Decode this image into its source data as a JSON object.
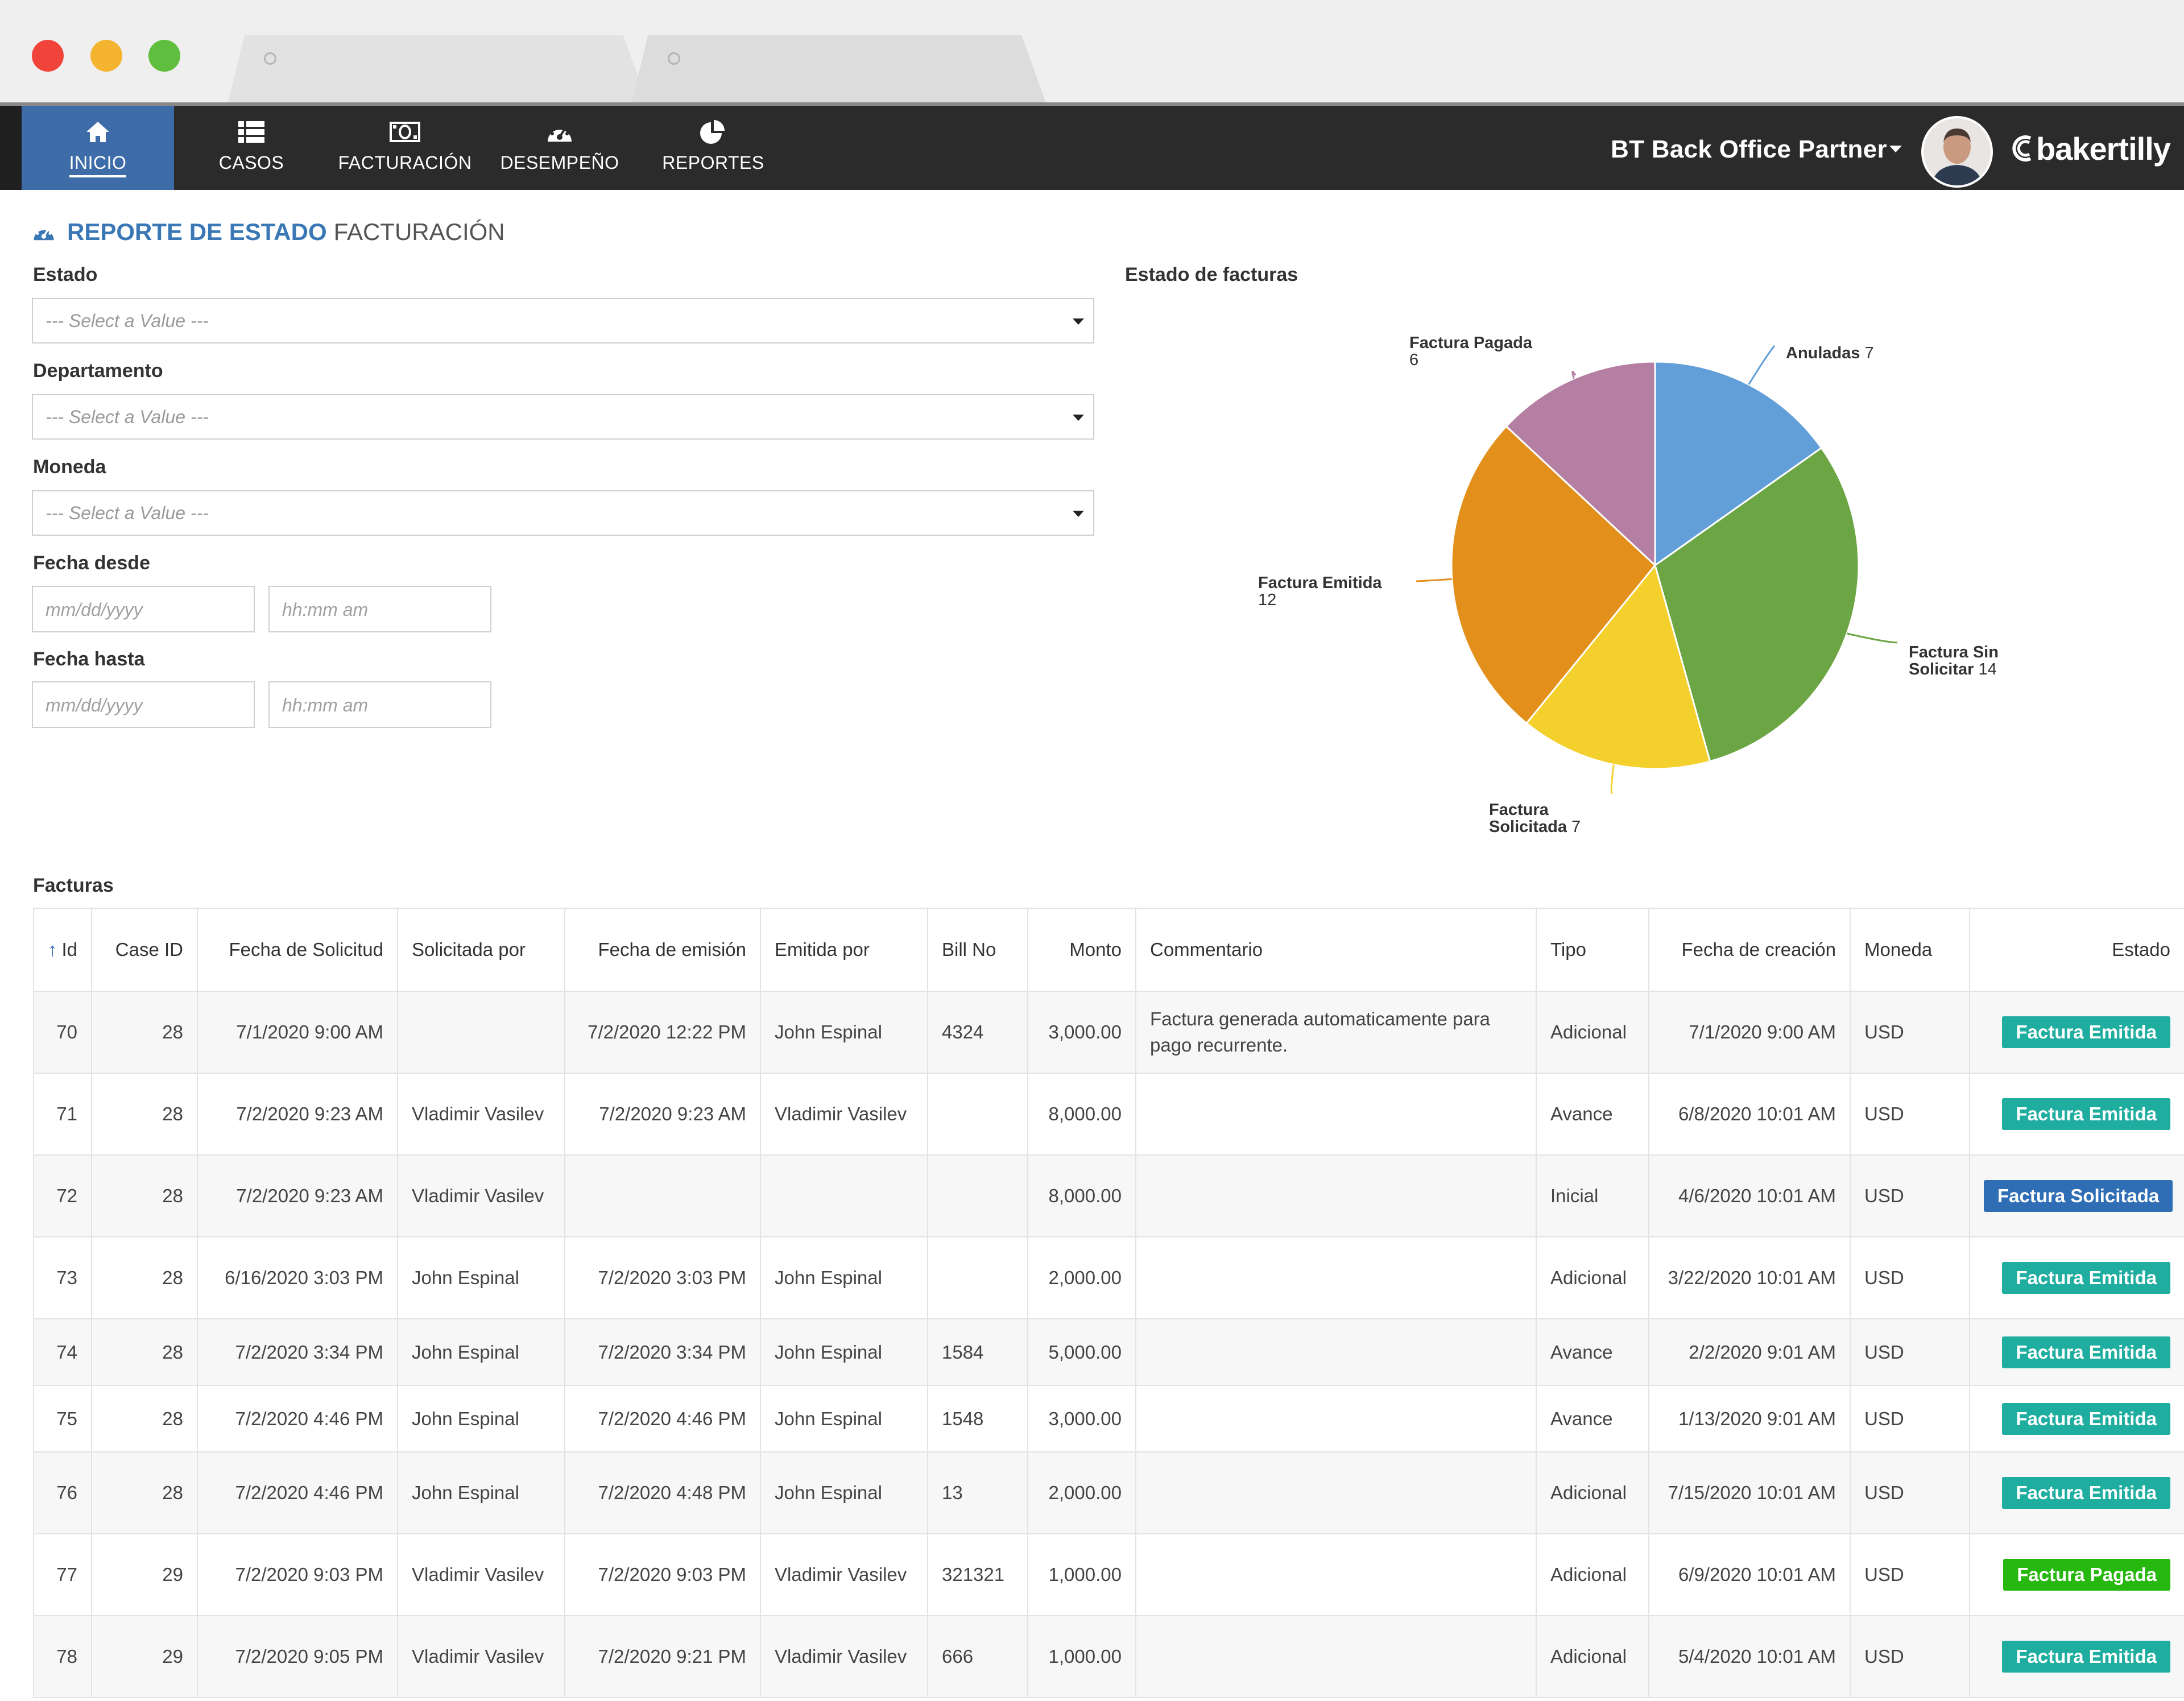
{
  "nav": {
    "items": [
      {
        "label": "INICIO",
        "icon": "home-icon",
        "active": true
      },
      {
        "label": "CASOS",
        "icon": "list-icon",
        "active": false
      },
      {
        "label": "FACTURACIÓN",
        "icon": "money-icon",
        "active": false
      },
      {
        "label": "DESEMPEÑO",
        "icon": "dashboard-icon",
        "active": false
      },
      {
        "label": "REPORTES",
        "icon": "pie-chart-icon",
        "active": false
      }
    ],
    "user_name": "BT Back Office Partner",
    "brand": "bakertilly"
  },
  "page": {
    "title_bold": "REPORTE DE ESTADO",
    "title_rest": "FACTURACIÓN"
  },
  "filters": {
    "estado": {
      "label": "Estado",
      "placeholder": "--- Select a Value ---"
    },
    "departamento": {
      "label": "Departamento",
      "placeholder": "--- Select a Value ---"
    },
    "moneda": {
      "label": "Moneda",
      "placeholder": "--- Select a Value ---"
    },
    "fecha_desde": {
      "label": "Fecha desde",
      "date_placeholder": "mm/dd/yyyy",
      "time_placeholder": "hh:mm am"
    },
    "fecha_hasta": {
      "label": "Fecha hasta",
      "date_placeholder": "mm/dd/yyyy",
      "time_placeholder": "hh:mm am"
    }
  },
  "chart_data": {
    "type": "pie",
    "title": "Estado de facturas",
    "slices": [
      {
        "label": "Anuladas",
        "value": 7,
        "color": "#629fd8"
      },
      {
        "label": "Factura Sin Solicitar",
        "value": 14,
        "color": "#6ba544"
      },
      {
        "label": "Factura Solicitada",
        "value": 7,
        "color": "#f4d02c"
      },
      {
        "label": "Factura Emitida",
        "value": 12,
        "color": "#e38f1b"
      },
      {
        "label": "Factura Pagada",
        "value": 6,
        "color": "#b47fa3"
      }
    ]
  },
  "table": {
    "title": "Facturas",
    "columns": [
      "Id",
      "Case ID",
      "Fecha de Solicitud",
      "Solicitada por",
      "Fecha de emisión",
      "Emitida por",
      "Bill No",
      "Monto",
      "Commentario",
      "Tipo",
      "Fecha de creación",
      "Moneda",
      "Estado"
    ],
    "rows": [
      {
        "id": "70",
        "case": "28",
        "fsol": "7/1/2020 9:00 AM",
        "solpor": "",
        "femi": "7/2/2020 12:22 PM",
        "emipor": "John Espinal",
        "bill": "4324",
        "monto": "3,000.00",
        "com": "Factura generada automaticamente para pago recurrente.",
        "tipo": "Adicional",
        "fcre": "7/1/2020 9:00 AM",
        "mon": "USD",
        "estado": "Factura Emitida",
        "ecolor": "#1fad9f"
      },
      {
        "id": "71",
        "case": "28",
        "fsol": "7/2/2020 9:23 AM",
        "solpor": "Vladimir Vasilev",
        "femi": "7/2/2020 9:23 AM",
        "emipor": "Vladimir Vasilev",
        "bill": "",
        "monto": "8,000.00",
        "com": "",
        "tipo": "Avance",
        "fcre": "6/8/2020 10:01 AM",
        "mon": "USD",
        "estado": "Factura Emitida",
        "ecolor": "#1fad9f"
      },
      {
        "id": "72",
        "case": "28",
        "fsol": "7/2/2020 9:23 AM",
        "solpor": "Vladimir Vasilev",
        "femi": "",
        "emipor": "",
        "bill": "",
        "monto": "8,000.00",
        "com": "",
        "tipo": "Inicial",
        "fcre": "4/6/2020 10:01 AM",
        "mon": "USD",
        "estado": "Factura Solicitada",
        "ecolor": "#2f6eb5"
      },
      {
        "id": "73",
        "case": "28",
        "fsol": "6/16/2020 3:03 PM",
        "solpor": "John Espinal",
        "femi": "7/2/2020 3:03 PM",
        "emipor": "John Espinal",
        "bill": "",
        "monto": "2,000.00",
        "com": "",
        "tipo": "Adicional",
        "fcre": "3/22/2020 10:01 AM",
        "mon": "USD",
        "estado": "Factura Emitida",
        "ecolor": "#1fad9f"
      },
      {
        "id": "74",
        "case": "28",
        "fsol": "7/2/2020 3:34 PM",
        "solpor": "John Espinal",
        "femi": "7/2/2020 3:34 PM",
        "emipor": "John Espinal",
        "bill": "1584",
        "monto": "5,000.00",
        "com": "",
        "tipo": "Avance",
        "fcre": "2/2/2020 9:01 AM",
        "mon": "USD",
        "estado": "Factura Emitida",
        "ecolor": "#1fad9f"
      },
      {
        "id": "75",
        "case": "28",
        "fsol": "7/2/2020 4:46 PM",
        "solpor": "John Espinal",
        "femi": "7/2/2020 4:46 PM",
        "emipor": "John Espinal",
        "bill": "1548",
        "monto": "3,000.00",
        "com": "",
        "tipo": "Avance",
        "fcre": "1/13/2020 9:01 AM",
        "mon": "USD",
        "estado": "Factura Emitida",
        "ecolor": "#1fad9f"
      },
      {
        "id": "76",
        "case": "28",
        "fsol": "7/2/2020 4:46 PM",
        "solpor": "John Espinal",
        "femi": "7/2/2020 4:48 PM",
        "emipor": "John Espinal",
        "bill": "13",
        "monto": "2,000.00",
        "com": "",
        "tipo": "Adicional",
        "fcre": "7/15/2020 10:01 AM",
        "mon": "USD",
        "estado": "Factura Emitida",
        "ecolor": "#1fad9f"
      },
      {
        "id": "77",
        "case": "29",
        "fsol": "7/2/2020 9:03 PM",
        "solpor": "Vladimir Vasilev",
        "femi": "7/2/2020 9:03 PM",
        "emipor": "Vladimir Vasilev",
        "bill": "321321",
        "monto": "1,000.00",
        "com": "",
        "tipo": "Adicional",
        "fcre": "6/9/2020 10:01 AM",
        "mon": "USD",
        "estado": "Factura Pagada",
        "ecolor": "#27b80f"
      },
      {
        "id": "78",
        "case": "29",
        "fsol": "7/2/2020 9:05 PM",
        "solpor": "Vladimir Vasilev",
        "femi": "7/2/2020 9:21 PM",
        "emipor": "Vladimir Vasilev",
        "bill": "666",
        "monto": "1,000.00",
        "com": "",
        "tipo": "Adicional",
        "fcre": "5/4/2020 10:01 AM",
        "mon": "USD",
        "estado": "Factura Emitida",
        "ecolor": "#1fad9f"
      }
    ]
  }
}
